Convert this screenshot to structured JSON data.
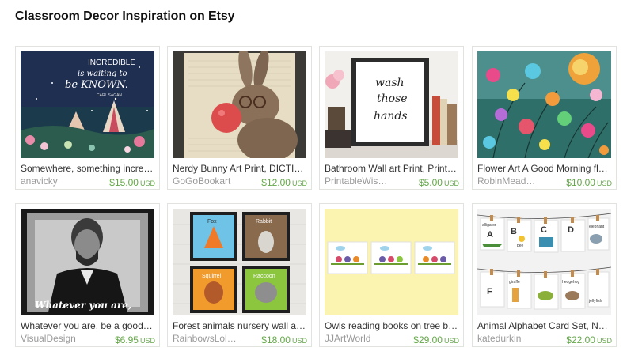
{
  "section": {
    "title": "Classroom Decor Inspiration on Etsy"
  },
  "listings": [
    {
      "name": "Somewhere, something incre…",
      "shop": "anavicky",
      "price": "$15.00",
      "currency": "USD",
      "image_text": [
        "INCREDIBLE",
        "is waiting to",
        "be KNOWN.",
        "CARL SAGAN"
      ]
    },
    {
      "name": "Nerdy Bunny Art Print, DICTI…",
      "shop": "GoGoBookart",
      "price": "$12.00",
      "currency": "USD"
    },
    {
      "name": "Bathroom Wall art Print, Print…",
      "shop": "PrintableWis…",
      "price": "$5.00",
      "currency": "USD",
      "image_text": [
        "wash",
        "those",
        "hands"
      ]
    },
    {
      "name": "Flower Art A Good Morning fl…",
      "shop": "RobinMead…",
      "price": "$10.00",
      "currency": "USD"
    },
    {
      "name": "Whatever you are, be a good…",
      "shop": "VisualDesign",
      "price": "$6.95",
      "currency": "USD",
      "image_text": [
        "Whatever you are,"
      ]
    },
    {
      "name": "Forest animals nursery wall a…",
      "shop": "RainbowsLol…",
      "price": "$18.00",
      "currency": "USD",
      "image_text": [
        "Fox",
        "Rabbit",
        "Squirrel",
        "Raccoon"
      ]
    },
    {
      "name": "Owls reading books on tree b…",
      "shop": "JJArtWorld",
      "price": "$29.00",
      "currency": "USD"
    },
    {
      "name": "Animal Alphabet Card Set, N…",
      "shop": "katedurkin",
      "price": "$22.00",
      "currency": "USD",
      "image_text": [
        "alligator",
        "A",
        "B",
        "bee",
        "C",
        "D",
        "elephant",
        "F",
        "giraffe",
        "hedgehog",
        "jellyfish"
      ]
    }
  ]
}
